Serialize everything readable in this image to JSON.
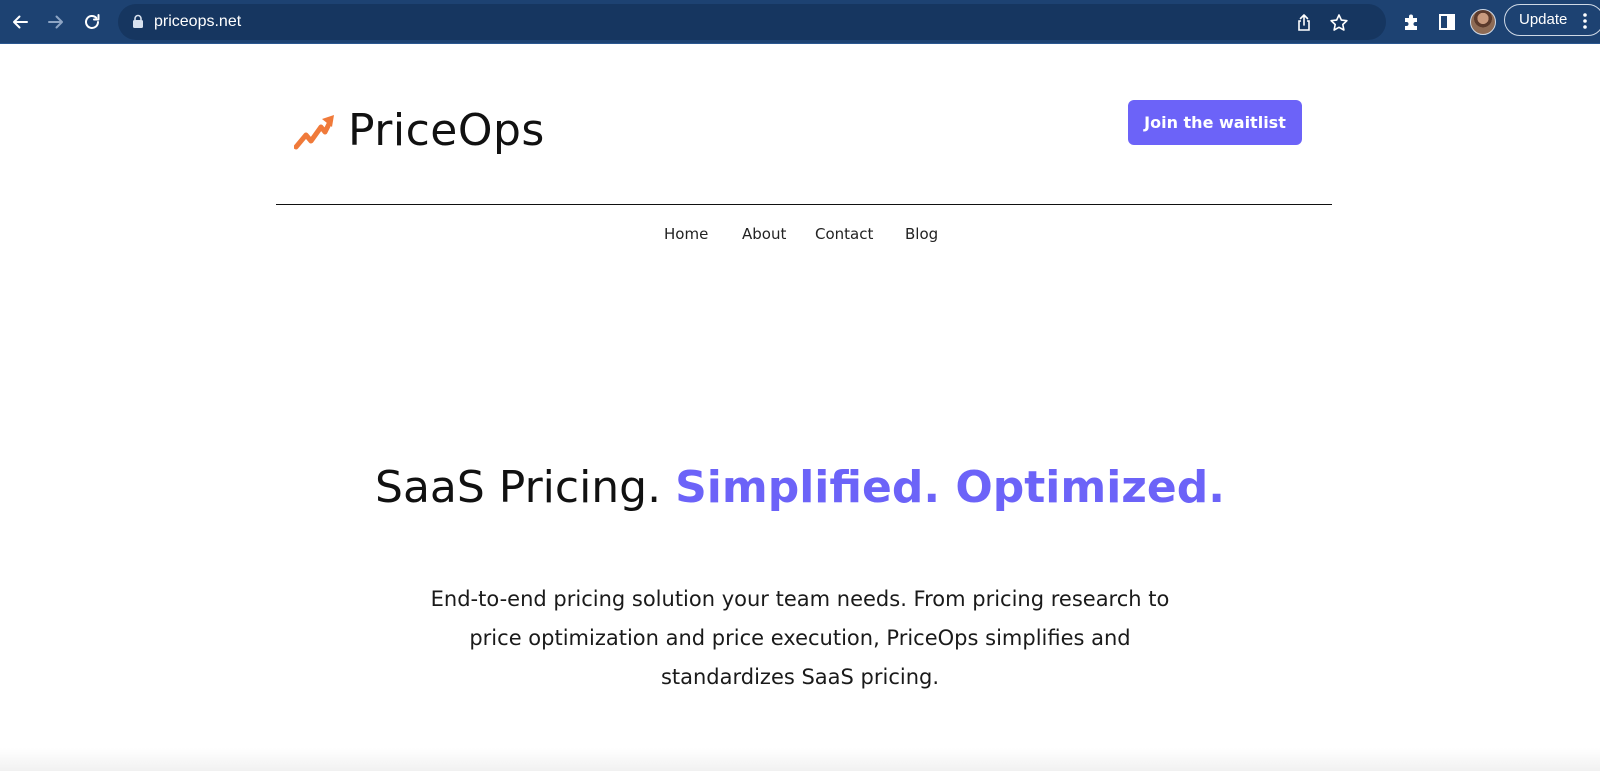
{
  "browser": {
    "url": "priceops.net",
    "update_label": "Update",
    "icons": {
      "back": "arrow-left-icon",
      "forward": "arrow-right-icon",
      "reload": "reload-icon",
      "lock": "lock-icon",
      "share": "share-icon",
      "bookmark": "star-icon",
      "extensions": "puzzle-icon",
      "side_panel": "side-panel-icon",
      "profile": "avatar",
      "menu": "more-vertical-icon"
    }
  },
  "site": {
    "logo_text": "PriceOps",
    "cta_label": "Join the waitlist",
    "nav": [
      "Home",
      "About",
      "Contact",
      "Blog"
    ]
  },
  "hero": {
    "title_plain": "SaaS Pricing. ",
    "title_accent": "Simplified. Optimized.",
    "subtitle_lines": [
      "End-to-end pricing solution your team needs. From pricing research to",
      "price optimization and price execution, PriceOps simplifies and",
      "standardizes SaaS pricing."
    ]
  },
  "colors": {
    "browser_bar": "#1d4272",
    "accent": "#6c63f8",
    "logo_arrow": "#f07a3a"
  }
}
